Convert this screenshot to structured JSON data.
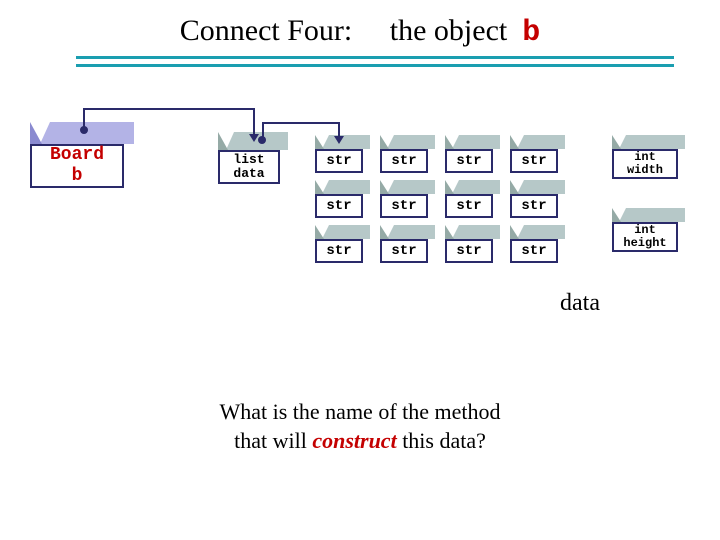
{
  "title": {
    "left": "Connect Four:",
    "mid": "the object",
    "b": "b"
  },
  "boxes": {
    "board": {
      "line1": "Board",
      "line2": "b"
    },
    "listdata": {
      "line1": "list",
      "line2": "data"
    },
    "width": {
      "line1": "int",
      "line2": "width"
    },
    "height": {
      "line1": "int",
      "line2": "height"
    }
  },
  "chart_data": {
    "type": "table",
    "rows": 3,
    "cols": 4,
    "cell_label": "str",
    "grid": [
      [
        "str",
        "str",
        "str",
        "str"
      ],
      [
        "str",
        "str",
        "str",
        "str"
      ],
      [
        "str",
        "str",
        "str",
        "str"
      ]
    ]
  },
  "labels": {
    "data_caption": "data"
  },
  "question": {
    "line1": "What is the name of the method",
    "line2_pre": "that will ",
    "construct": "construct",
    "line2_post": " this data?"
  }
}
